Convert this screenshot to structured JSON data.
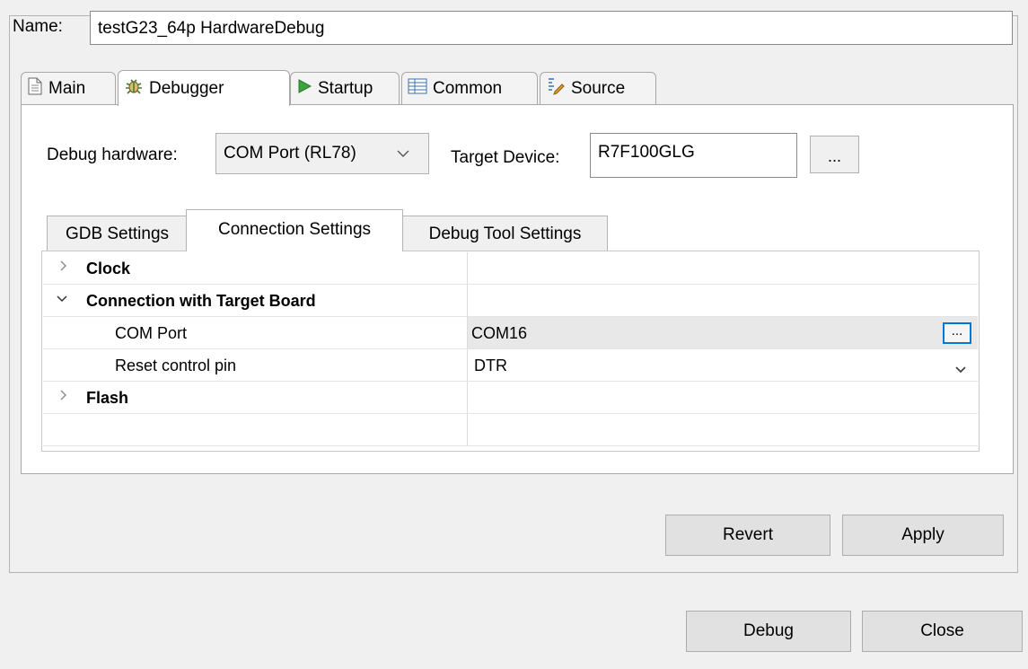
{
  "name": {
    "label": "Name:",
    "value": "testG23_64p HardwareDebug"
  },
  "tabs": [
    {
      "label": "Main",
      "icon": "document-icon"
    },
    {
      "label": "Debugger",
      "icon": "bug-icon"
    },
    {
      "label": "Startup",
      "icon": "play-icon"
    },
    {
      "label": "Common",
      "icon": "table-icon"
    },
    {
      "label": "Source",
      "icon": "source-icon"
    }
  ],
  "debugger": {
    "hardware_label": "Debug hardware:",
    "hardware_value": "COM Port (RL78)",
    "target_label": "Target Device:",
    "target_value": "R7F100GLG",
    "browse_label": "..."
  },
  "subtabs": [
    {
      "label": "GDB Settings"
    },
    {
      "label": "Connection Settings"
    },
    {
      "label": "Debug Tool Settings"
    }
  ],
  "tree": {
    "rows": [
      {
        "label": "Clock",
        "value": "",
        "expanded": false
      },
      {
        "label": "Connection with Target Board",
        "value": "",
        "expanded": true
      },
      {
        "label": "COM Port",
        "value": "COM16"
      },
      {
        "label": "Reset control pin",
        "value": "DTR"
      },
      {
        "label": "Flash",
        "value": "",
        "expanded": false
      }
    ],
    "com_browse_label": "..."
  },
  "buttons": {
    "revert": "Revert",
    "apply": "Apply",
    "debug": "Debug",
    "close": "Close"
  },
  "colors": {
    "selected_cell": "#e8e8e8",
    "focus_blue": "#0078d7"
  }
}
